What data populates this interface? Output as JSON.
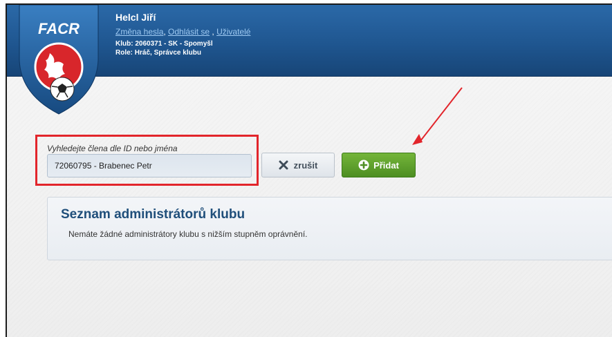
{
  "header": {
    "logo_text": "FACR",
    "username": "Helcl Jiří",
    "links": [
      "Změna hesla",
      "Odhlásit se",
      "Uživatelé"
    ],
    "link_separators": [
      ", ",
      " , "
    ],
    "club": "Klub: 2060371 - SK - Spomyšl",
    "role": "Role: Hráč, Správce klubu"
  },
  "search": {
    "label": "Vyhledejte člena dle ID nebo jména",
    "value": "72060795 - Brabenec Petr"
  },
  "buttons": {
    "cancel": "zrušit",
    "add": "Přidat"
  },
  "panel": {
    "title": "Seznam administrátorů klubu",
    "text": "Nemáte žádné administrátory klubu s nižším stupněm oprávnění."
  },
  "colors": {
    "header": "#1f5690",
    "highlight": "#e2252b",
    "add_button": "#5c9e2c",
    "panel_title": "#1f4e7a"
  },
  "icons": [
    "facr-logo-icon",
    "close-x-icon",
    "plus-circle-icon",
    "red-arrow-annotation"
  ]
}
